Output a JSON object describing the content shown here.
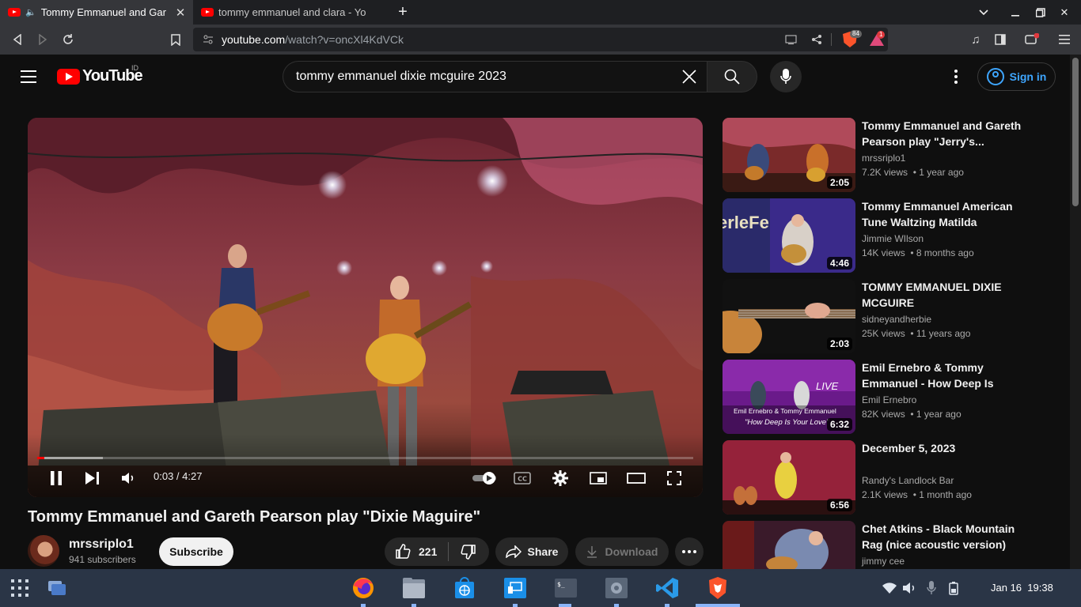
{
  "browser": {
    "tabs": [
      {
        "title": "Tommy Emmanuel and Gar",
        "active": true,
        "playing_audio": true
      },
      {
        "title": "tommy emmanuel and clara - Yo",
        "active": false,
        "playing_audio": false
      }
    ],
    "url_host": "youtube.com",
    "url_path": "/watch?v=oncXl4KdVCk",
    "shields_count": "84",
    "rewards_count": "1"
  },
  "header": {
    "logo_text": "YouTube",
    "country_code": "ID",
    "search_query": "tommy emmanuel dixie mcguire 2023",
    "sign_in_label": "Sign in"
  },
  "player": {
    "current_time": "0:03",
    "duration": "4:27",
    "time_display": "0:03 / 4:27",
    "played_fraction": 0.011,
    "buffered_fraction": 0.1
  },
  "video": {
    "title": "Tommy Emmanuel and Gareth Pearson play \"Dixie Maguire\"",
    "channel": "mrssriplo1",
    "subscribers": "941 subscribers",
    "subscribe_label": "Subscribe",
    "likes": "221",
    "share_label": "Share",
    "download_label": "Download"
  },
  "related": [
    {
      "title": "Tommy Emmanuel and Gareth Pearson play \"Jerry's...",
      "channel": "mrssriplo1",
      "views": "7.2K views",
      "age": "1 year ago",
      "duration": "2:05"
    },
    {
      "title": "Tommy Emmanuel American Tune Waltzing Matilda",
      "channel": "Jimmie WIlson",
      "views": "14K views",
      "age": "8 months ago",
      "duration": "4:46"
    },
    {
      "title": "TOMMY EMMANUEL DIXIE MCGUIRE",
      "channel": "sidneyandherbie",
      "views": "25K views",
      "age": "11 years ago",
      "duration": "2:03"
    },
    {
      "title": "Emil Ernebro & Tommy Emmanuel - How Deep Is Your...",
      "channel": "Emil Ernebro",
      "views": "82K views",
      "age": "1 year ago",
      "duration": "6:32",
      "thumb_tag": "LIVE",
      "thumb_caption_1": "Emil Ernebro & Tommy Emmanuel",
      "thumb_caption_2": "\"How Deep Is Your Love\""
    },
    {
      "title": "December 5, 2023",
      "channel": "Randy's Landlock Bar",
      "views": "2.1K views",
      "age": "1 month ago",
      "duration": "6:56"
    },
    {
      "title": "Chet Atkins - Black Mountain Rag (nice acoustic version)",
      "channel": "jimmy cee",
      "views": "",
      "age": "",
      "duration": ""
    }
  ],
  "thumb2_sign": "erleFe",
  "taskbar": {
    "date": "Jan 16",
    "time": "19:38"
  },
  "colors": {
    "accent_red": "#ff0000",
    "link_blue": "#3ea6ff",
    "background": "#0f0f0f",
    "taskbar": "#2a3546"
  }
}
